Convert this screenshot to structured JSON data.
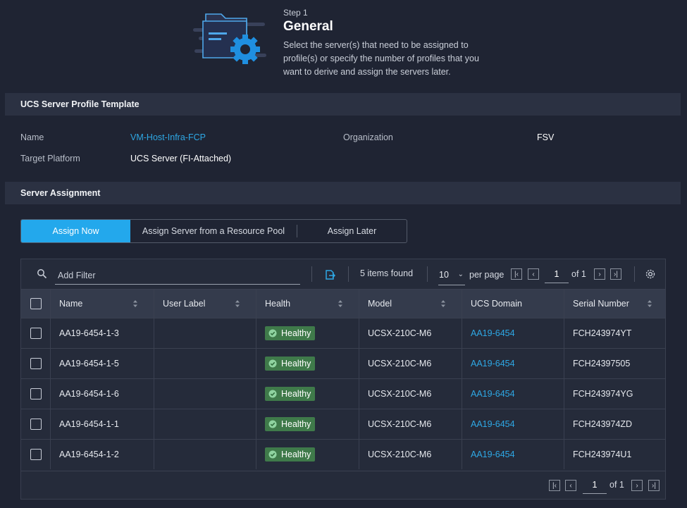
{
  "step": {
    "label": "Step 1",
    "title": "General",
    "description": "Select the server(s) that need to be assigned to profile(s) or specify the number of profiles that you want to derive and assign the servers later."
  },
  "template_section": {
    "title": "UCS Server Profile Template",
    "name_label": "Name",
    "name_value": "VM-Host-Infra-FCP",
    "org_label": "Organization",
    "org_value": "FSV",
    "platform_label": "Target Platform",
    "platform_value": "UCS Server (FI-Attached)"
  },
  "assignment_section": {
    "title": "Server Assignment",
    "tabs": [
      {
        "label": "Assign Now",
        "active": true
      },
      {
        "label": "Assign Server from a Resource Pool",
        "active": false
      },
      {
        "label": "Assign Later",
        "active": false
      }
    ]
  },
  "toolbar": {
    "filter_placeholder": "Add Filter",
    "items_found": "5 items found",
    "per_page_value": "10",
    "per_page_label": "per page",
    "page_current": "1",
    "page_of": "of 1"
  },
  "table": {
    "columns": [
      "Name",
      "User Label",
      "Health",
      "Model",
      "UCS Domain",
      "Serial Number"
    ],
    "rows": [
      {
        "name": "AA19-6454-1-3",
        "user_label": "",
        "health": "Healthy",
        "model": "UCSX-210C-M6",
        "domain": "AA19-6454",
        "serial": "FCH243974YT"
      },
      {
        "name": "AA19-6454-1-5",
        "user_label": "",
        "health": "Healthy",
        "model": "UCSX-210C-M6",
        "domain": "AA19-6454",
        "serial": "FCH24397505"
      },
      {
        "name": "AA19-6454-1-6",
        "user_label": "",
        "health": "Healthy",
        "model": "UCSX-210C-M6",
        "domain": "AA19-6454",
        "serial": "FCH243974YG"
      },
      {
        "name": "AA19-6454-1-1",
        "user_label": "",
        "health": "Healthy",
        "model": "UCSX-210C-M6",
        "domain": "AA19-6454",
        "serial": "FCH243974ZD"
      },
      {
        "name": "AA19-6454-1-2",
        "user_label": "",
        "health": "Healthy",
        "model": "UCSX-210C-M6",
        "domain": "AA19-6454",
        "serial": "FCH243974U1"
      }
    ]
  },
  "footer_pager": {
    "page_current": "1",
    "page_of": "of 1"
  },
  "colors": {
    "background": "#1f2433",
    "accent": "#23a8ec",
    "link": "#2ea8e5",
    "healthy": "#3f7a4a"
  },
  "icons": [
    "folder-gear-icon",
    "search-icon",
    "export-icon",
    "gear-icon",
    "sort-icon",
    "check-circle-icon",
    "first-page-icon",
    "prev-page-icon",
    "next-page-icon",
    "last-page-icon",
    "chevron-down-icon"
  ]
}
